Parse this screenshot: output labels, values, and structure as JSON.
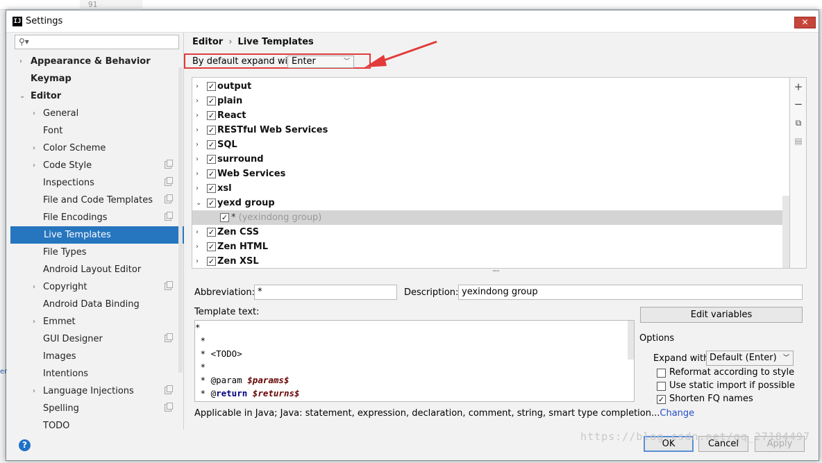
{
  "background": {
    "line_number": "91"
  },
  "window": {
    "title": "Settings",
    "close_glyph": "✕"
  },
  "search": {
    "placeholder": "",
    "icon": "search-icon"
  },
  "sidebar": {
    "items": [
      {
        "label": "Appearance & Behavior",
        "arrow": "›",
        "bold": true
      },
      {
        "label": "Keymap",
        "bold": true
      },
      {
        "label": "Editor",
        "arrow": "⌄",
        "bold": true
      },
      {
        "label": "General",
        "arrow": "›"
      },
      {
        "label": "Font"
      },
      {
        "label": "Color Scheme",
        "arrow": "›"
      },
      {
        "label": "Code Style",
        "arrow": "›",
        "copy": true
      },
      {
        "label": "Inspections",
        "copy": true
      },
      {
        "label": "File and Code Templates",
        "copy": true
      },
      {
        "label": "File Encodings",
        "copy": true
      },
      {
        "label": "Live Templates",
        "selected": true
      },
      {
        "label": "File Types"
      },
      {
        "label": "Android Layout Editor"
      },
      {
        "label": "Copyright",
        "arrow": "›",
        "copy": true
      },
      {
        "label": "Android Data Binding"
      },
      {
        "label": "Emmet",
        "arrow": "›"
      },
      {
        "label": "GUI Designer",
        "copy": true
      },
      {
        "label": "Images"
      },
      {
        "label": "Intentions"
      },
      {
        "label": "Language Injections",
        "arrow": "›",
        "copy": true
      },
      {
        "label": "Spelling",
        "copy": true
      },
      {
        "label": "TODO"
      }
    ]
  },
  "breadcrumb": {
    "first": "Editor",
    "separator": "›",
    "second": "Live Templates"
  },
  "expand_default": {
    "label": "By default expand with",
    "value": "Enter"
  },
  "template_groups": [
    {
      "label": "output",
      "checked": true
    },
    {
      "label": "plain",
      "checked": true
    },
    {
      "label": "React",
      "checked": true
    },
    {
      "label": "RESTful Web Services",
      "checked": true
    },
    {
      "label": "SQL",
      "checked": true
    },
    {
      "label": "surround",
      "checked": true
    },
    {
      "label": "Web Services",
      "checked": true
    },
    {
      "label": "xsl",
      "checked": true
    },
    {
      "label": "yexd group",
      "checked": true,
      "expanded": true
    },
    {
      "label": "(yexindong group)",
      "abbr": "*",
      "checked": true,
      "child": true
    },
    {
      "label": "Zen CSS",
      "checked": true
    },
    {
      "label": "Zen HTML",
      "checked": true
    },
    {
      "label": "Zen XSL",
      "checked": true
    }
  ],
  "list_buttons": {
    "add": "+",
    "remove": "−",
    "copy_icon": "copy-icon",
    "restore_icon": "restore-icon"
  },
  "abbreviation": {
    "label": "Abbreviation:",
    "value": "*"
  },
  "description": {
    "label": "Description:",
    "value": "yexindong group"
  },
  "template_text": {
    "label": "Template text:",
    "lines": [
      "*",
      " * ",
      " * <TODO>",
      " *",
      " * @param ",
      " * @"
    ],
    "param_var": "$params$",
    "return_kw": "return",
    "return_var": "$returns$"
  },
  "edit_variables": {
    "label": "Edit variables"
  },
  "options": {
    "title": "Options",
    "expand_with_label": "Expand with",
    "expand_with_value": "Default (Enter)",
    "checkboxes": [
      {
        "label": "Reformat according to style",
        "checked": false
      },
      {
        "label": "Use static import if possible",
        "checked": false
      },
      {
        "label": "Shorten FQ names",
        "checked": true
      }
    ]
  },
  "applicable": {
    "text": "Applicable in Java; Java: statement, expression, declaration, comment, string, smart type completion...",
    "link": "Change"
  },
  "footer": {
    "help": "?",
    "ok": "OK",
    "cancel": "Cancel",
    "apply": "Apply"
  },
  "watermark": "https://blog.csdn.net/qq_27184497",
  "colors": {
    "selection": "#2675bf",
    "highlight_border": "#e23a3a",
    "link": "#2450c9",
    "close": "#c7453a"
  }
}
